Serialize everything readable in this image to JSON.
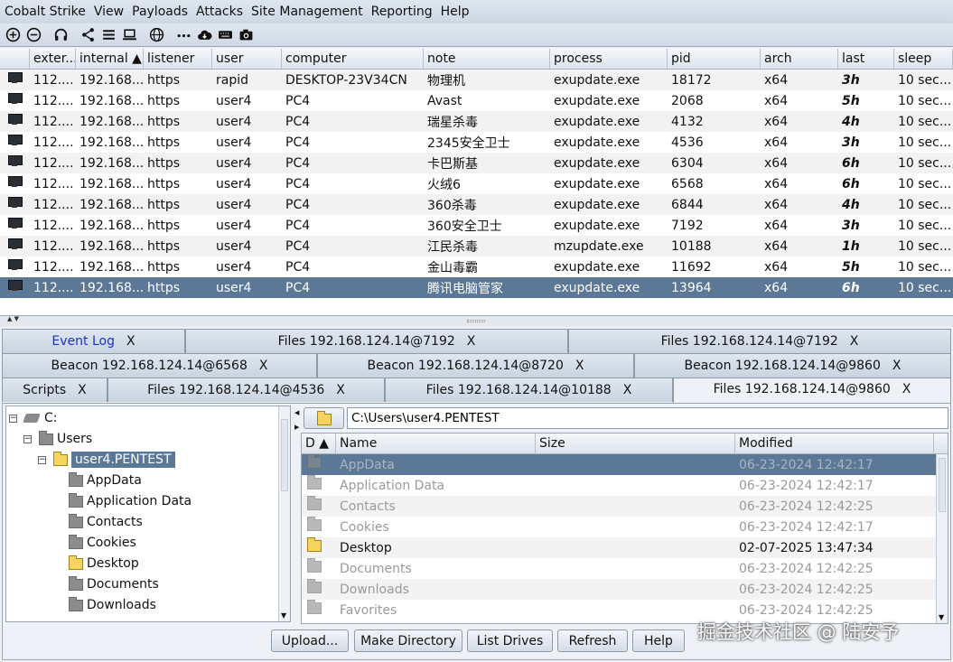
{
  "menu": [
    "Cobalt Strike",
    "View",
    "Payloads",
    "Attacks",
    "Site Management",
    "Reporting",
    "Help"
  ],
  "toolbar_icons": [
    "plus-circle-icon",
    "minus-circle-icon",
    "headphones-icon",
    "share-icon",
    "list-icon",
    "laptop-icon",
    "globe-icon",
    "dots-icon",
    "cloud-download-icon",
    "keyboard-icon",
    "camera-icon"
  ],
  "beacons": {
    "columns": [
      "",
      "exter...",
      "internal ▲",
      "listener",
      "user",
      "computer",
      "note",
      "process",
      "pid",
      "arch",
      "last",
      "sleep"
    ],
    "rows": [
      {
        "external": "112....",
        "internal": "192.168...",
        "listener": "https",
        "user": "rapid",
        "computer": "DESKTOP-23V34CN",
        "note": "物理机",
        "process": "exupdate.exe",
        "pid": "18172",
        "arch": "x64",
        "last": "3h",
        "sleep": "10 sec..."
      },
      {
        "external": "112....",
        "internal": "192.168...",
        "listener": "https",
        "user": "user4",
        "computer": "PC4",
        "note": "Avast",
        "process": "exupdate.exe",
        "pid": "2068",
        "arch": "x64",
        "last": "5h",
        "sleep": "10 sec..."
      },
      {
        "external": "112....",
        "internal": "192.168...",
        "listener": "https",
        "user": "user4",
        "computer": "PC4",
        "note": "瑞星杀毒",
        "process": "exupdate.exe",
        "pid": "4132",
        "arch": "x64",
        "last": "4h",
        "sleep": "10 sec..."
      },
      {
        "external": "112....",
        "internal": "192.168...",
        "listener": "https",
        "user": "user4",
        "computer": "PC4",
        "note": "2345安全卫士",
        "process": "exupdate.exe",
        "pid": "4536",
        "arch": "x64",
        "last": "3h",
        "sleep": "10 sec..."
      },
      {
        "external": "112....",
        "internal": "192.168...",
        "listener": "https",
        "user": "user4",
        "computer": "PC4",
        "note": "卡巴斯基",
        "process": "exupdate.exe",
        "pid": "6304",
        "arch": "x64",
        "last": "6h",
        "sleep": "10 sec..."
      },
      {
        "external": "112....",
        "internal": "192.168...",
        "listener": "https",
        "user": "user4",
        "computer": "PC4",
        "note": "火绒6",
        "process": "exupdate.exe",
        "pid": "6568",
        "arch": "x64",
        "last": "6h",
        "sleep": "10 sec..."
      },
      {
        "external": "112....",
        "internal": "192.168...",
        "listener": "https",
        "user": "user4",
        "computer": "PC4",
        "note": "360杀毒",
        "process": "exupdate.exe",
        "pid": "6844",
        "arch": "x64",
        "last": "4h",
        "sleep": "10 sec..."
      },
      {
        "external": "112....",
        "internal": "192.168...",
        "listener": "https",
        "user": "user4",
        "computer": "PC4",
        "note": "360安全卫士",
        "process": "exupdate.exe",
        "pid": "7192",
        "arch": "x64",
        "last": "3h",
        "sleep": "10 sec..."
      },
      {
        "external": "112....",
        "internal": "192.168...",
        "listener": "https",
        "user": "user4",
        "computer": "PC4",
        "note": "江民杀毒",
        "process": "mzupdate.exe",
        "pid": "10188",
        "arch": "x64",
        "last": "1h",
        "sleep": "10 sec..."
      },
      {
        "external": "112....",
        "internal": "192.168...",
        "listener": "https",
        "user": "user4",
        "computer": "PC4",
        "note": "金山毒霸",
        "process": "exupdate.exe",
        "pid": "11692",
        "arch": "x64",
        "last": "5h",
        "sleep": "10 sec..."
      },
      {
        "external": "112....",
        "internal": "192.168...",
        "listener": "https",
        "user": "user4",
        "computer": "PC4",
        "note": "腾讯电脑管家",
        "process": "exupdate.exe",
        "pid": "13964",
        "arch": "x64",
        "last": "6h",
        "sleep": "10 sec..."
      }
    ]
  },
  "tabs": {
    "close": "X",
    "row1": [
      "Event Log",
      "Files 192.168.124.14@7192",
      "Files 192.168.124.14@7192"
    ],
    "row2": [
      "Beacon 192.168.124.14@6568",
      "Beacon 192.168.124.14@8720",
      "Beacon 192.168.124.14@9860"
    ],
    "row3": [
      "Scripts",
      "Files 192.168.124.14@4536",
      "Files 192.168.124.14@10188",
      "Files 192.168.124.14@9860"
    ]
  },
  "tree": {
    "toggle_open": "−",
    "nodes": [
      "C:",
      "Users",
      "user4.PENTEST",
      "AppData",
      "Application Data",
      "Contacts",
      "Cookies",
      "Desktop",
      "Documents",
      "Downloads"
    ]
  },
  "path": "C:\\Users\\user4.PENTEST",
  "files": {
    "columns": [
      "D ▲",
      "Name",
      "Size",
      "Modified"
    ],
    "rows": [
      {
        "name": "AppData",
        "size": "",
        "modified": "06-23-2024 12:42:17"
      },
      {
        "name": "Application Data",
        "size": "",
        "modified": "06-23-2024 12:42:17"
      },
      {
        "name": "Contacts",
        "size": "",
        "modified": "06-23-2024 12:42:25"
      },
      {
        "name": "Cookies",
        "size": "",
        "modified": "06-23-2024 12:42:17"
      },
      {
        "name": "Desktop",
        "size": "",
        "modified": "02-07-2025 13:47:34"
      },
      {
        "name": "Documents",
        "size": "",
        "modified": "06-23-2024 12:42:25"
      },
      {
        "name": "Downloads",
        "size": "",
        "modified": "06-23-2024 12:42:25"
      },
      {
        "name": "Favorites",
        "size": "",
        "modified": "06-23-2024 12:42:25"
      }
    ]
  },
  "buttons": {
    "upload": "Upload...",
    "make_dir": "Make Directory",
    "list_drives": "List Drives",
    "refresh": "Refresh",
    "help": "Help"
  },
  "watermark": "掘金技术社区 @ 陆安予"
}
